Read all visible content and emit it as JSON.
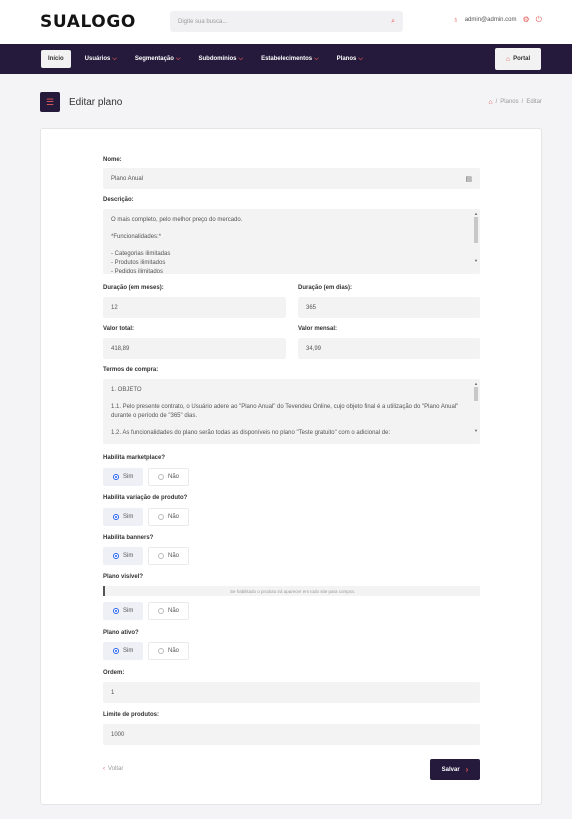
{
  "header": {
    "logo": "SUALOGO",
    "search_placeholder": "Digite sua busca...",
    "user_email": "admin@admin.com"
  },
  "nav": {
    "items": [
      "Início",
      "Usuários",
      "Segmentação",
      "Subdomínios",
      "Estabelecimentos",
      "Planos"
    ],
    "portal": "Portal"
  },
  "page": {
    "title": "Editar plano",
    "breadcrumb": [
      "Planos",
      "Editar"
    ]
  },
  "form": {
    "nome": {
      "label": "Nome:",
      "value": "Plano Anual"
    },
    "descricao": {
      "label": "Descrição:",
      "value": "O mais completo, pelo melhor preço do mercado.\n\n*Funcionalidades:*\n\n- Categorias ilimitadas\n- Produtos ilimitados\n- Pedidos ilimitados"
    },
    "duracao_meses": {
      "label": "Duração (em meses):",
      "value": "12"
    },
    "duracao_dias": {
      "label": "Duração (em dias):",
      "value": "365"
    },
    "valor_total": {
      "label": "Valor total:",
      "value": "418,89"
    },
    "valor_mensal": {
      "label": "Valor mensal:",
      "value": "34,99"
    },
    "termos": {
      "label": "Termos de compra:",
      "value": "1. OBJETO\n\n1.1. Pelo presente contrato, o Usuário adere ao \"Plano Anual\" do Tevendeu Online, cujo objeto final é a utilização do \"Plano Anual\" durante o período de \"365\" dias.\n\n1.2. As funcionalidades do plano serão todas as disponíveis no plano \"Teste gratuito\" com o adicional de:"
    },
    "marketplace": {
      "label": "Habilita marketplace?"
    },
    "variacao": {
      "label": "Habilita variação de produto?"
    },
    "banners": {
      "label": "Habilita banners?"
    },
    "visivel": {
      "label": "Plano visível?",
      "hint": "Se habilitado o produto irá aparecer em todo site para compra."
    },
    "ativo": {
      "label": "Plano ativo?"
    },
    "ordem": {
      "label": "Ordem:",
      "value": "1"
    },
    "limite": {
      "label": "Limite de produtos:",
      "value": "1000"
    },
    "radio_sim": "Sim",
    "radio_nao": "Não",
    "back": "Voltar",
    "save": "Salvar"
  },
  "colors": {
    "primary": "#261a3c",
    "accent": "#e55b5b",
    "radio": "#2563eb"
  },
  "icons": [
    "search-icon",
    "user-icon",
    "gear-icon",
    "power-icon",
    "chevron-down-icon",
    "home-icon",
    "list-icon",
    "contact-card-icon",
    "chevron-left-icon",
    "chevron-right-icon"
  ]
}
